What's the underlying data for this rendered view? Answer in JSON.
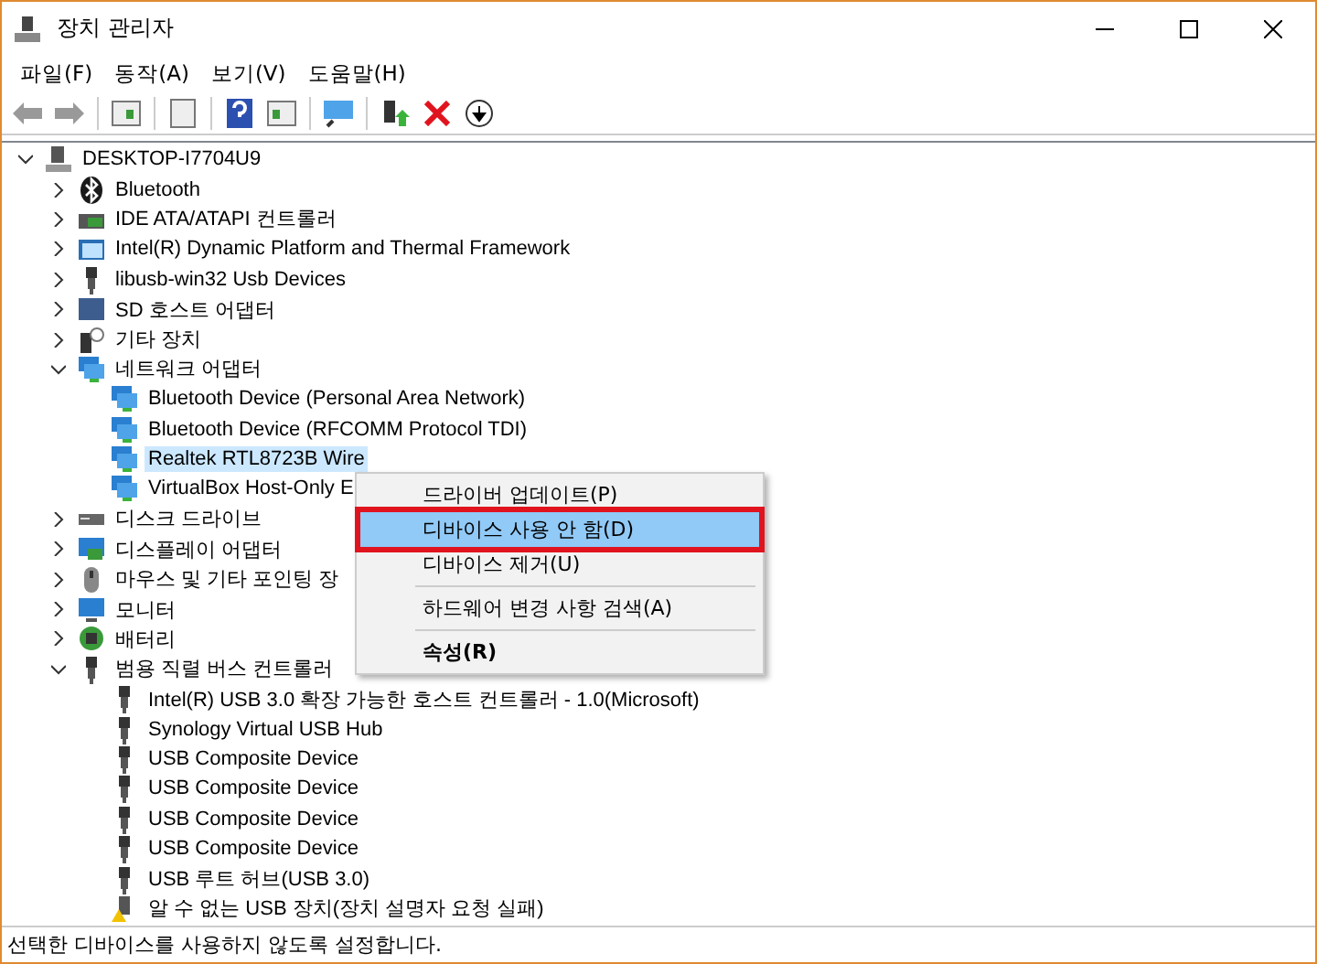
{
  "window": {
    "title": "장치 관리자"
  },
  "menu_bar": [
    "파일(F)",
    "동작(A)",
    "보기(V)",
    "도움말(H)"
  ],
  "tree": {
    "label": "DESKTOP-I7704U9",
    "kind": "computer",
    "expanded": true,
    "selected": false,
    "children": [
      {
        "label": "Bluetooth",
        "kind": "bluetooth",
        "expanded": false,
        "selected": false
      },
      {
        "label": "IDE ATA/ATAPI 컨트롤러",
        "kind": "controller",
        "expanded": false,
        "selected": false
      },
      {
        "label": "Intel(R) Dynamic Platform and Thermal Framework",
        "kind": "system",
        "expanded": false,
        "selected": false
      },
      {
        "label": "libusb-win32 Usb Devices",
        "kind": "usb",
        "expanded": false,
        "selected": false
      },
      {
        "label": "SD 호스트 어댑터",
        "kind": "card",
        "expanded": false,
        "selected": false
      },
      {
        "label": "기타 장치",
        "kind": "unknown",
        "expanded": false,
        "selected": false
      },
      {
        "label": "네트워크 어댑터",
        "kind": "network",
        "expanded": true,
        "selected": false,
        "children": [
          {
            "label": "Bluetooth Device (Personal Area Network)",
            "kind": "network",
            "selected": false
          },
          {
            "label": "Bluetooth Device (RFCOMM Protocol TDI)",
            "kind": "network",
            "selected": false
          },
          {
            "label": "Realtek RTL8723B Wire",
            "kind": "network",
            "selected": true
          },
          {
            "label": "VirtualBox Host-Only E",
            "kind": "network",
            "selected": false
          }
        ]
      },
      {
        "label": "디스크 드라이브",
        "kind": "drive",
        "expanded": false,
        "selected": false
      },
      {
        "label": "디스플레이 어댑터",
        "kind": "display",
        "expanded": false,
        "selected": false
      },
      {
        "label": "마우스 및 기타 포인팅 장",
        "kind": "mouse",
        "expanded": false,
        "selected": false
      },
      {
        "label": "모니터",
        "kind": "monitor",
        "expanded": false,
        "selected": false
      },
      {
        "label": "배터리",
        "kind": "battery",
        "expanded": false,
        "selected": false
      },
      {
        "label": "범용 직렬 버스 컨트롤러",
        "kind": "usb",
        "expanded": true,
        "selected": false,
        "children": [
          {
            "label": "Intel(R) USB 3.0 확장 가능한 호스트 컨트롤러 - 1.0(Microsoft)",
            "kind": "usb",
            "selected": false
          },
          {
            "label": "Synology Virtual USB Hub",
            "kind": "usb",
            "selected": false
          },
          {
            "label": "USB Composite Device",
            "kind": "usb",
            "selected": false
          },
          {
            "label": "USB Composite Device",
            "kind": "usb",
            "selected": false
          },
          {
            "label": "USB Composite Device",
            "kind": "usb",
            "selected": false
          },
          {
            "label": "USB Composite Device",
            "kind": "usb",
            "selected": false
          },
          {
            "label": "USB 루트 허브(USB 3.0)",
            "kind": "usb",
            "selected": false
          },
          {
            "label": "알 수 없는 USB 장치(장치 설명자 요청 실패)",
            "kind": "warning",
            "selected": false
          }
        ]
      }
    ]
  },
  "context_menu": [
    {
      "label": "드라이버 업데이트(P)",
      "selected": false,
      "bold": false,
      "divider_after": false
    },
    {
      "label": "디바이스 사용 안 함(D)",
      "selected": true,
      "bold": false,
      "divider_after": false
    },
    {
      "label": "디바이스 제거(U)",
      "selected": false,
      "bold": false,
      "divider_after": true
    },
    {
      "label": "하드웨어 변경 사항 검색(A)",
      "selected": false,
      "bold": false,
      "divider_after": true
    },
    {
      "label": "속성(R)",
      "selected": false,
      "bold": true,
      "divider_after": false
    }
  ],
  "status_bar": "선택한 디바이스를 사용하지 않도록 설정합니다."
}
